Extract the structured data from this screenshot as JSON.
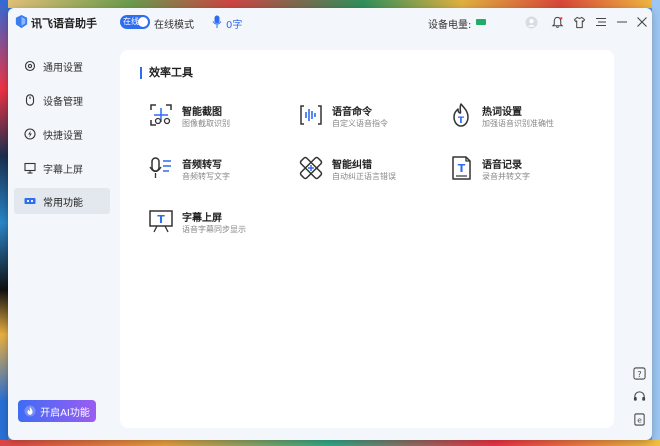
{
  "app": {
    "name": "讯飞语音助手",
    "status_label": "在线",
    "mode": "在线模式",
    "word_count": "0字",
    "battery_label": "设备电量:"
  },
  "colors": {
    "accent": "#2e6cf0",
    "battery": "#1fae6a",
    "ai_gradient_start": "#3f6cf5",
    "ai_gradient_end": "#9b5cf2"
  },
  "sidebar": {
    "items": [
      {
        "label": "通用设置",
        "icon": "gear-icon"
      },
      {
        "label": "设备管理",
        "icon": "mouse-icon"
      },
      {
        "label": "快捷设置",
        "icon": "lightning-icon"
      },
      {
        "label": "字幕上屏",
        "icon": "subtitle-icon"
      },
      {
        "label": "常用功能",
        "icon": "function-icon",
        "active": true
      }
    ],
    "ai_button": "开启AI功能"
  },
  "main": {
    "section_title": "效率工具",
    "tools": [
      {
        "name": "智能截图",
        "desc": "图像截取识别",
        "icon": "screenshot-icon"
      },
      {
        "name": "语音命令",
        "desc": "自定义语音指令",
        "icon": "voice-command-icon"
      },
      {
        "name": "热词设置",
        "desc": "加强语音识别准确性",
        "icon": "hotword-icon"
      },
      {
        "name": "音频转写",
        "desc": "音频转写文字",
        "icon": "audio-transcribe-icon"
      },
      {
        "name": "智能纠错",
        "desc": "自动纠正语言错误",
        "icon": "correction-icon"
      },
      {
        "name": "语音记录",
        "desc": "录音并转文字",
        "icon": "voice-record-icon"
      },
      {
        "name": "字幕上屏",
        "desc": "语音字幕同步显示",
        "icon": "subtitle-screen-icon"
      }
    ]
  }
}
